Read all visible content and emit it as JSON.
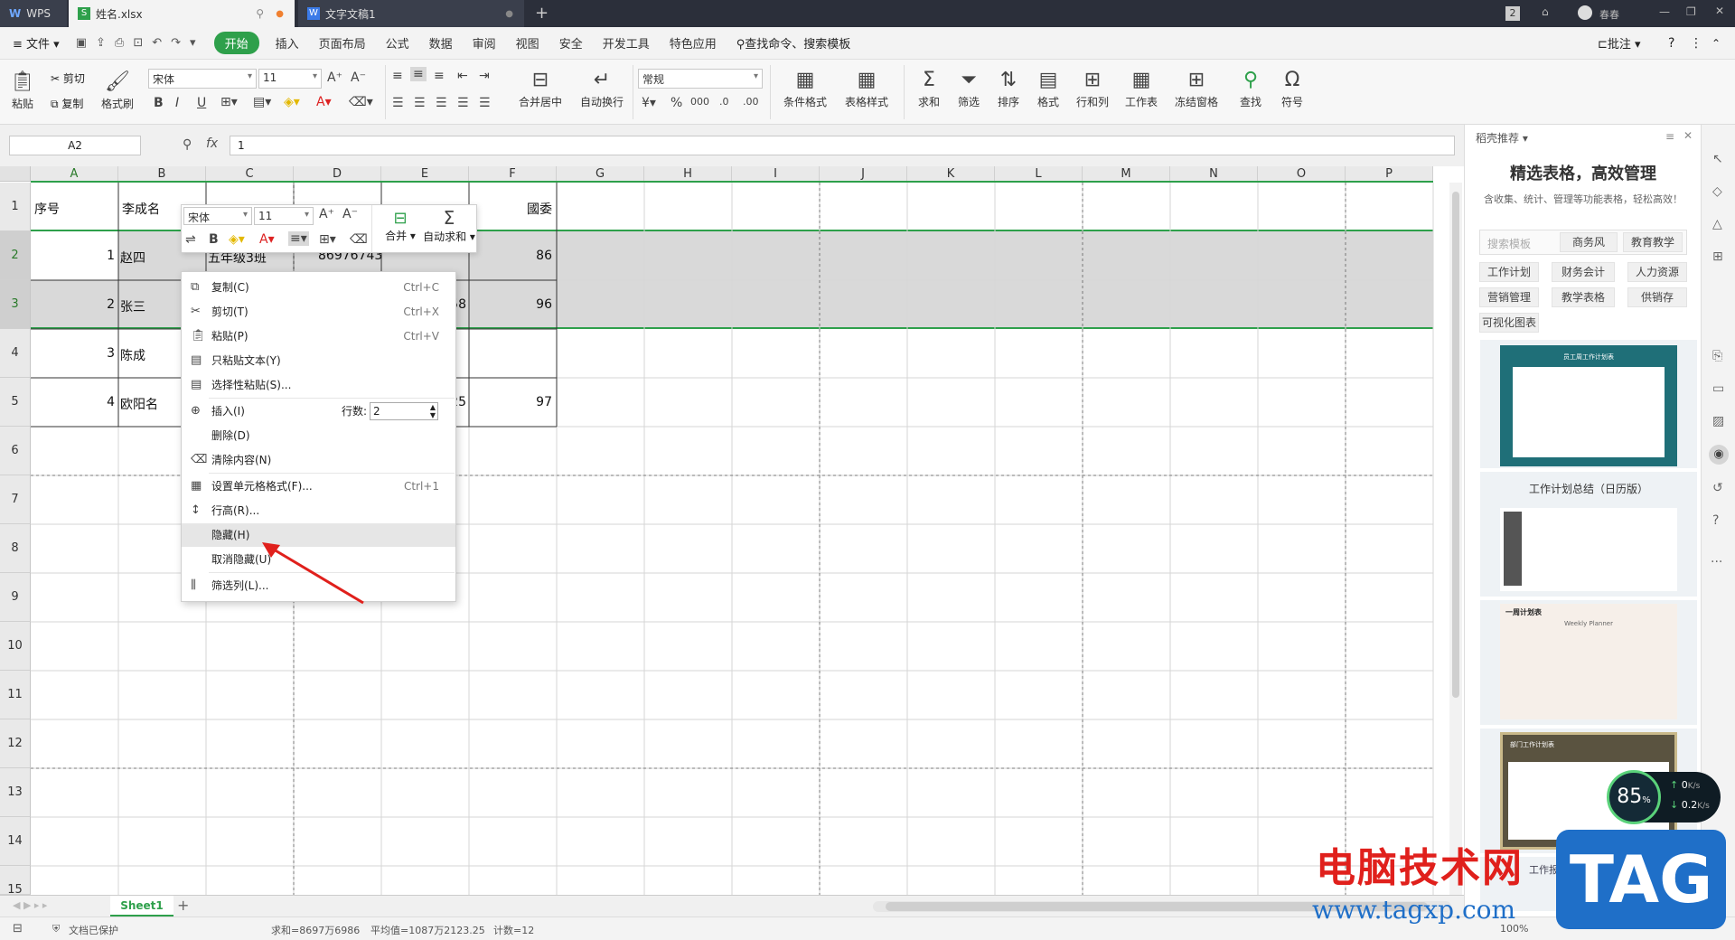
{
  "titlebar": {
    "tabs": [
      {
        "label": "WPS"
      },
      {
        "label": "姓名.xlsx"
      },
      {
        "label": "文字文稿1"
      }
    ],
    "new_tab": "+",
    "page_badge": "2",
    "user": "春春"
  },
  "menu": {
    "file": "文件",
    "start": "开始",
    "items": [
      "插入",
      "页面布局",
      "公式",
      "数据",
      "审阅",
      "视图",
      "安全",
      "开发工具",
      "特色应用"
    ],
    "search": "查找命令、搜索模板",
    "annotate": "批注",
    "help": "?"
  },
  "toolbar": {
    "paste": "粘贴",
    "cut": "剪切",
    "copy": "复制",
    "format_painter": "格式刷",
    "font": "宋体",
    "font_size": "11",
    "merge_center": "合并居中",
    "wrap": "自动换行",
    "number_format": "常规",
    "cond_format": "条件格式",
    "table_style": "表格样式",
    "sum": "求和",
    "filter": "筛选",
    "sort": "排序",
    "format": "格式",
    "row_col": "行和列",
    "worksheet": "工作表",
    "freeze": "冻结窗格",
    "find": "查找",
    "symbol": "符号",
    "bold": "B",
    "italic": "I",
    "underline": "U"
  },
  "formula_bar": {
    "name_box": "A2",
    "fx": "fx",
    "value": "1"
  },
  "columns": [
    "A",
    "B",
    "C",
    "D",
    "E",
    "F",
    "G",
    "H",
    "I",
    "J",
    "K",
    "L",
    "M",
    "N",
    "O",
    "P"
  ],
  "rows": [
    "1",
    "2",
    "3",
    "4",
    "5",
    "6",
    "7",
    "8",
    "9",
    "10",
    "11",
    "12",
    "13",
    "14",
    "15"
  ],
  "cells": {
    "a1": "序号",
    "b1": "李成名",
    "f1": "國委",
    "a2": "1",
    "b2": "赵四",
    "c2": "五年级3班",
    "d2": "86976743",
    "f2": "86",
    "a3": "2",
    "b3": "张三",
    "e3": "58",
    "f3": "96",
    "a4": "3",
    "b4": "陈成",
    "a5": "4",
    "b5": "欧阳名",
    "e5": "25",
    "f5": "97"
  },
  "mini_toolbar": {
    "font": "宋体",
    "size": "11",
    "merge": "合并",
    "autosum": "自动求和",
    "bold": "B"
  },
  "context_menu": {
    "copy": {
      "label": "复制(C)",
      "shortcut": "Ctrl+C"
    },
    "cut": {
      "label": "剪切(T)",
      "shortcut": "Ctrl+X"
    },
    "paste": {
      "label": "粘贴(P)",
      "shortcut": "Ctrl+V"
    },
    "paste_text": "只粘贴文本(Y)",
    "paste_special": "选择性粘贴(S)...",
    "insert": "插入(I)",
    "rows_label": "行数:",
    "rows_value": "2",
    "delete": "删除(D)",
    "clear": "清除内容(N)",
    "format_cells": {
      "label": "设置单元格格式(F)...",
      "shortcut": "Ctrl+1"
    },
    "row_height": "行高(R)...",
    "hide": "隐藏(H)",
    "unhide": "取消隐藏(U)",
    "filter_col": "筛选列(L)..."
  },
  "sheet_tabs": [
    "Sheet1"
  ],
  "status": {
    "protected": "文档已保护",
    "sum": "求和=8697万6986",
    "avg": "平均值=1087万2123.25",
    "count": "计数=12",
    "zoom": "100%"
  },
  "right_panel": {
    "header": "稻壳推荐",
    "title": "精选表格，高效管理",
    "subtitle": "含收集、统计、管理等功能表格，轻松高效！",
    "search_placeholder": "搜索模板",
    "tags_top": [
      "商务风",
      "教育教学"
    ],
    "tags": [
      "工作计划",
      "财务会计",
      "人力资源",
      "营销管理",
      "教学表格",
      "供销存",
      "可视化图表"
    ],
    "card_titles": [
      "员工周工作计划表",
      "工作计划总结（日历版）",
      "一周计划表",
      "Weekly Planner",
      "部门工作计划表",
      "工作报表"
    ]
  },
  "net_widget": {
    "percent": "85",
    "up": "0",
    "down": "0.2",
    "unit": "K/s"
  },
  "watermark": {
    "text": "电脑技术网",
    "url": "www.tagxp.com",
    "logo": "TAG"
  },
  "colors": {
    "accent_green": "#2ea04b",
    "title_bg": "#2b2f3a",
    "arrow_red": "#e0201c"
  }
}
